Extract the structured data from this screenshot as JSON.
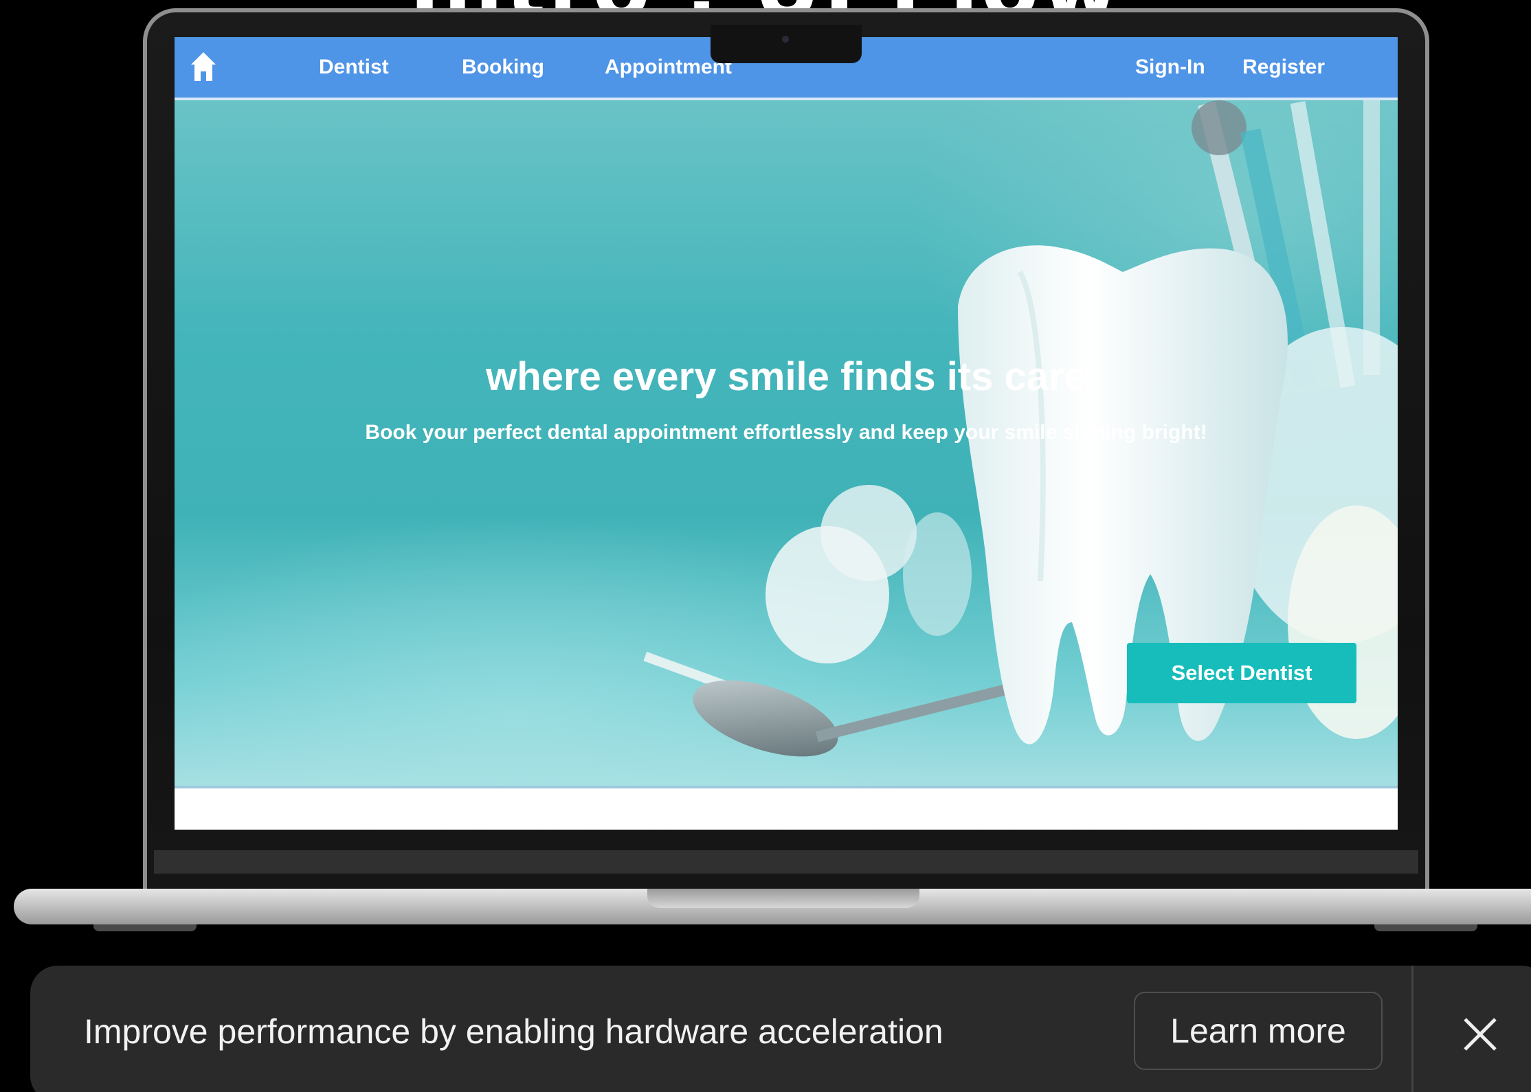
{
  "slide": {
    "heading": "Intro : UI Flow"
  },
  "site": {
    "nav": {
      "home_icon": "home-icon",
      "links": [
        {
          "label": "Dentist"
        },
        {
          "label": "Booking"
        },
        {
          "label": "Appointment"
        }
      ],
      "auth": [
        {
          "label": "Sign-In"
        },
        {
          "label": "Register"
        }
      ],
      "bar_color": "#4e94e7"
    },
    "hero": {
      "title": "where every smile finds its care",
      "subtitle": "Book your perfect dental appointment effortlessly and keep your smile shining bright!",
      "cta_label": "Select Dentist",
      "cta_color": "#16bdbb",
      "background_color": "#43b5bb"
    }
  },
  "notification": {
    "message": "Improve performance by enabling hardware acceleration",
    "learn_more_label": "Learn more",
    "close_icon": "close-icon"
  }
}
